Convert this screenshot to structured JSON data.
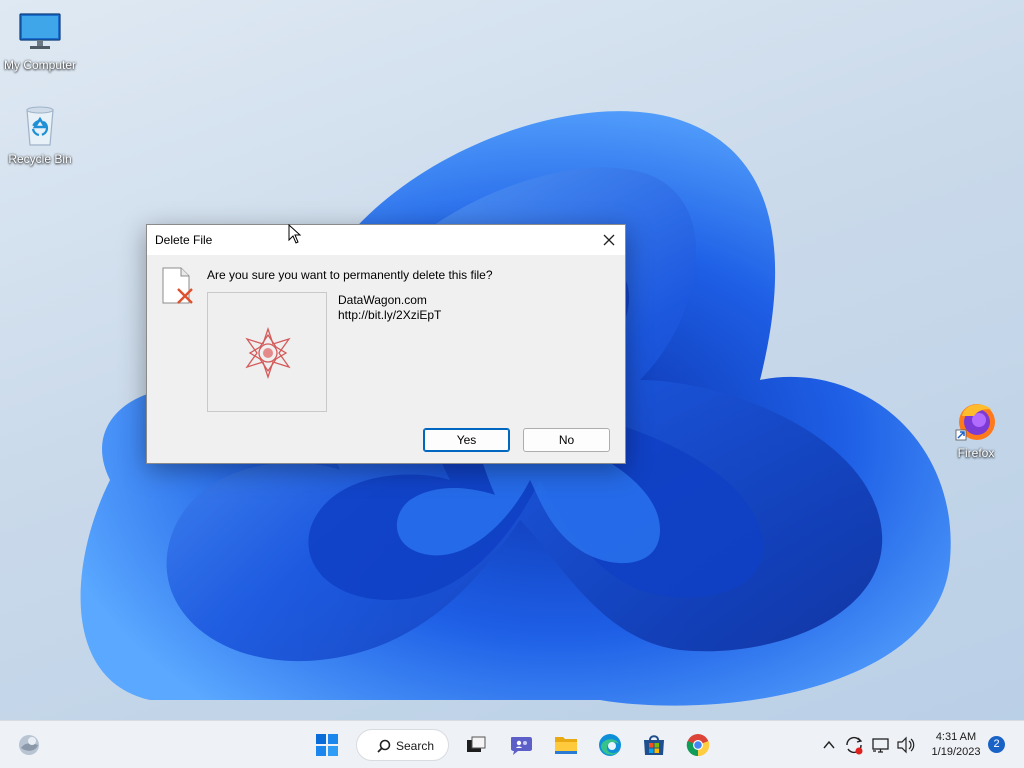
{
  "desktop": {
    "icons": [
      {
        "label": "My Computer"
      },
      {
        "label": "Recycle Bin"
      },
      {
        "label": "Firefox"
      }
    ]
  },
  "dialog": {
    "title": "Delete File",
    "question": "Are you sure you want to permanently delete this file?",
    "file_name": "DataWagon.com",
    "file_url": "http://bit.ly/2XziEpT",
    "yes_label": "Yes",
    "no_label": "No"
  },
  "taskbar": {
    "search_label": "Search",
    "apps": [
      "widgets-icon",
      "start-icon",
      "search-icon",
      "task-view-icon",
      "chat-icon",
      "file-explorer-icon",
      "edge-icon",
      "store-icon",
      "chrome-icon"
    ],
    "time": "4:31 AM",
    "date": "1/19/2023",
    "notification_count": "2"
  },
  "colors": {
    "accent": "#0067c0",
    "taskbar_bg": "#eef1f6",
    "dialog_bg": "#f0f0f0",
    "wallpaper_blue": "#1d5be0"
  }
}
